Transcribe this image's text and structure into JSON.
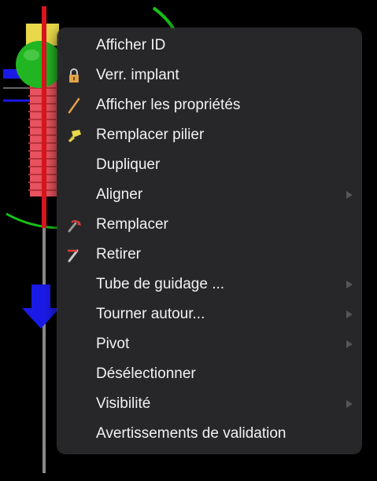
{
  "menu": {
    "items": [
      {
        "label": "Afficher ID",
        "icon": "",
        "submenu": false
      },
      {
        "label": "Verr. implant",
        "icon": "padlock-icon",
        "submenu": false
      },
      {
        "label": "Afficher les propriétés",
        "icon": "pencil-icon",
        "submenu": false
      },
      {
        "label": "Remplacer pilier",
        "icon": "abutment-icon",
        "submenu": false
      },
      {
        "label": "Dupliquer",
        "icon": "",
        "submenu": false
      },
      {
        "label": "Aligner",
        "icon": "",
        "submenu": true
      },
      {
        "label": "Remplacer",
        "icon": "replace-implant-icon",
        "submenu": false
      },
      {
        "label": "Retirer",
        "icon": "remove-implant-icon",
        "submenu": false
      },
      {
        "label": "Tube de guidage ...",
        "icon": "",
        "submenu": true
      },
      {
        "label": "Tourner autour...",
        "icon": "",
        "submenu": true
      },
      {
        "label": "Pivot",
        "icon": "",
        "submenu": true
      },
      {
        "label": "Désélectionner",
        "icon": "",
        "submenu": false
      },
      {
        "label": "Visibilité",
        "icon": "",
        "submenu": true
      },
      {
        "label": "Avertissements de validation",
        "icon": "",
        "submenu": false
      }
    ]
  },
  "colors": {
    "menu_background": "#28282a",
    "menu_text": "#f2f2f2",
    "submenu_arrow": "#555558",
    "implant_red": "#e8535f",
    "implant_shaft_red": "#d9161e",
    "sphere_green": "#22b522",
    "axis_blue": "#1a1ae6",
    "axis_green": "#17c217",
    "implant_yellow": "#e8d84a",
    "padlock_orange": "#e0a24a"
  }
}
